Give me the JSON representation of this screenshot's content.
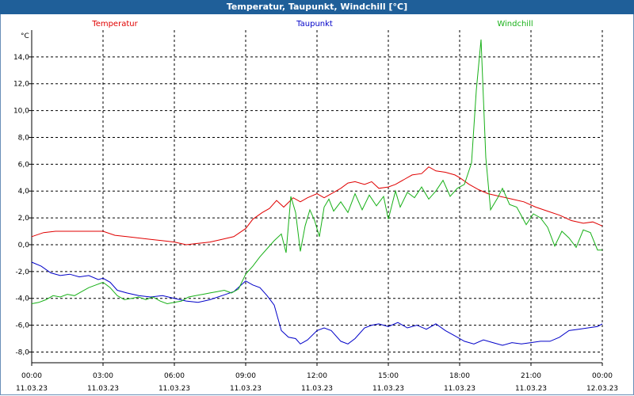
{
  "title": "Temperatur, Taupunkt, Windchill [°C]",
  "chart_data": {
    "type": "line",
    "ylabel": "°C",
    "ylim": [
      -8.8,
      16.0
    ],
    "xlim_hours": [
      0,
      24
    ],
    "y_ticks": [
      "14,0",
      "12,0",
      "10,0",
      "8,0",
      "6,0",
      "4,0",
      "2,0",
      "0,0",
      "-2,0",
      "-4,0",
      "-6,0",
      "-8,0"
    ],
    "y_tick_values": [
      14,
      12,
      10,
      8,
      6,
      4,
      2,
      0,
      -2,
      -4,
      -6,
      -8
    ],
    "x_ticks": [
      {
        "time": "00:00",
        "date": "11.03.23",
        "h": 0
      },
      {
        "time": "03:00",
        "date": "11.03.23",
        "h": 3
      },
      {
        "time": "06:00",
        "date": "11.03.23",
        "h": 6
      },
      {
        "time": "09:00",
        "date": "11.03.23",
        "h": 9
      },
      {
        "time": "12:00",
        "date": "11.03.23",
        "h": 12
      },
      {
        "time": "15:00",
        "date": "11.03.23",
        "h": 15
      },
      {
        "time": "18:00",
        "date": "11.03.23",
        "h": 18
      },
      {
        "time": "21:00",
        "date": "11.03.23",
        "h": 21
      },
      {
        "time": "00:00",
        "date": "12.03.23",
        "h": 24
      }
    ],
    "grid": true,
    "legend_placement": "top",
    "series": [
      {
        "name": "Temperatur",
        "color": "#e00000",
        "points": [
          [
            0,
            0.6
          ],
          [
            0.5,
            0.9
          ],
          [
            1,
            1.0
          ],
          [
            1.5,
            1.0
          ],
          [
            2,
            1.0
          ],
          [
            2.5,
            1.0
          ],
          [
            3,
            1.0
          ],
          [
            3.5,
            0.7
          ],
          [
            4,
            0.6
          ],
          [
            4.5,
            0.5
          ],
          [
            5,
            0.4
          ],
          [
            5.5,
            0.3
          ],
          [
            6,
            0.2
          ],
          [
            6.5,
            0.0
          ],
          [
            7,
            0.1
          ],
          [
            7.5,
            0.2
          ],
          [
            8,
            0.4
          ],
          [
            8.5,
            0.6
          ],
          [
            9,
            1.2
          ],
          [
            9.3,
            1.9
          ],
          [
            9.7,
            2.4
          ],
          [
            10,
            2.7
          ],
          [
            10.3,
            3.3
          ],
          [
            10.6,
            2.8
          ],
          [
            11,
            3.5
          ],
          [
            11.3,
            3.2
          ],
          [
            11.6,
            3.5
          ],
          [
            12,
            3.8
          ],
          [
            12.3,
            3.5
          ],
          [
            12.7,
            3.9
          ],
          [
            13,
            4.2
          ],
          [
            13.3,
            4.6
          ],
          [
            13.6,
            4.7
          ],
          [
            14,
            4.5
          ],
          [
            14.3,
            4.7
          ],
          [
            14.6,
            4.2
          ],
          [
            15,
            4.3
          ],
          [
            15.3,
            4.5
          ],
          [
            15.7,
            4.9
          ],
          [
            16,
            5.2
          ],
          [
            16.4,
            5.3
          ],
          [
            16.7,
            5.8
          ],
          [
            17,
            5.5
          ],
          [
            17.4,
            5.4
          ],
          [
            17.8,
            5.2
          ],
          [
            18,
            5.0
          ],
          [
            18.4,
            4.5
          ],
          [
            18.8,
            4.1
          ],
          [
            19.2,
            3.8
          ],
          [
            19.7,
            3.6
          ],
          [
            20.2,
            3.4
          ],
          [
            20.7,
            3.2
          ],
          [
            21.2,
            2.8
          ],
          [
            21.7,
            2.5
          ],
          [
            22.2,
            2.2
          ],
          [
            22.7,
            1.8
          ],
          [
            23.2,
            1.6
          ],
          [
            23.6,
            1.7
          ],
          [
            24,
            1.4
          ]
        ]
      },
      {
        "name": "Taupunkt",
        "color": "#0000c8",
        "points": [
          [
            0,
            -1.3
          ],
          [
            0.4,
            -1.6
          ],
          [
            0.8,
            -2.1
          ],
          [
            1.2,
            -2.3
          ],
          [
            1.6,
            -2.2
          ],
          [
            2,
            -2.4
          ],
          [
            2.4,
            -2.3
          ],
          [
            2.8,
            -2.6
          ],
          [
            3,
            -2.5
          ],
          [
            3.3,
            -2.8
          ],
          [
            3.6,
            -3.4
          ],
          [
            4,
            -3.6
          ],
          [
            4.5,
            -3.8
          ],
          [
            5,
            -3.9
          ],
          [
            5.5,
            -3.8
          ],
          [
            6,
            -4.0
          ],
          [
            6.5,
            -4.2
          ],
          [
            7,
            -4.3
          ],
          [
            7.5,
            -4.1
          ],
          [
            8,
            -3.8
          ],
          [
            8.5,
            -3.5
          ],
          [
            9,
            -2.7
          ],
          [
            9.3,
            -3.0
          ],
          [
            9.6,
            -3.2
          ],
          [
            9.9,
            -3.8
          ],
          [
            10.2,
            -4.5
          ],
          [
            10.5,
            -6.4
          ],
          [
            10.8,
            -6.9
          ],
          [
            11.1,
            -7.0
          ],
          [
            11.3,
            -7.4
          ],
          [
            11.6,
            -7.1
          ],
          [
            12,
            -6.4
          ],
          [
            12.3,
            -6.2
          ],
          [
            12.6,
            -6.4
          ],
          [
            13,
            -7.2
          ],
          [
            13.3,
            -7.4
          ],
          [
            13.6,
            -7.0
          ],
          [
            14,
            -6.2
          ],
          [
            14.3,
            -6.0
          ],
          [
            14.6,
            -5.9
          ],
          [
            15,
            -6.1
          ],
          [
            15.4,
            -5.8
          ],
          [
            15.8,
            -6.2
          ],
          [
            16.2,
            -6.0
          ],
          [
            16.6,
            -6.3
          ],
          [
            17,
            -5.9
          ],
          [
            17.4,
            -6.4
          ],
          [
            17.8,
            -6.8
          ],
          [
            18.2,
            -7.2
          ],
          [
            18.6,
            -7.4
          ],
          [
            19,
            -7.1
          ],
          [
            19.4,
            -7.3
          ],
          [
            19.8,
            -7.5
          ],
          [
            20.2,
            -7.3
          ],
          [
            20.6,
            -7.4
          ],
          [
            21,
            -7.3
          ],
          [
            21.4,
            -7.2
          ],
          [
            21.8,
            -7.2
          ],
          [
            22.2,
            -6.9
          ],
          [
            22.6,
            -6.4
          ],
          [
            23,
            -6.3
          ],
          [
            23.4,
            -6.2
          ],
          [
            23.8,
            -6.1
          ],
          [
            24,
            -5.9
          ]
        ]
      },
      {
        "name": "Windchill",
        "color": "#18b018",
        "points": [
          [
            0,
            -4.4
          ],
          [
            0.3,
            -4.3
          ],
          [
            0.6,
            -4.1
          ],
          [
            0.9,
            -3.8
          ],
          [
            1.2,
            -3.9
          ],
          [
            1.5,
            -3.7
          ],
          [
            1.8,
            -3.8
          ],
          [
            2.1,
            -3.5
          ],
          [
            2.4,
            -3.2
          ],
          [
            2.7,
            -3.0
          ],
          [
            3,
            -2.8
          ],
          [
            3.3,
            -3.2
          ],
          [
            3.6,
            -3.8
          ],
          [
            3.9,
            -4.1
          ],
          [
            4.2,
            -4.0
          ],
          [
            4.5,
            -3.9
          ],
          [
            4.8,
            -4.1
          ],
          [
            5.1,
            -3.9
          ],
          [
            5.4,
            -4.2
          ],
          [
            5.7,
            -4.4
          ],
          [
            6,
            -4.3
          ],
          [
            6.3,
            -4.2
          ],
          [
            6.6,
            -3.9
          ],
          [
            6.9,
            -3.8
          ],
          [
            7.2,
            -3.7
          ],
          [
            7.5,
            -3.6
          ],
          [
            7.8,
            -3.5
          ],
          [
            8.1,
            -3.4
          ],
          [
            8.4,
            -3.6
          ],
          [
            8.7,
            -3.3
          ],
          [
            9,
            -2.2
          ],
          [
            9.3,
            -1.6
          ],
          [
            9.6,
            -0.9
          ],
          [
            9.9,
            -0.3
          ],
          [
            10.2,
            0.3
          ],
          [
            10.5,
            0.8
          ],
          [
            10.7,
            -0.6
          ],
          [
            10.9,
            3.6
          ],
          [
            11.1,
            2.4
          ],
          [
            11.3,
            -0.5
          ],
          [
            11.5,
            1.4
          ],
          [
            11.7,
            2.6
          ],
          [
            11.9,
            1.8
          ],
          [
            12.1,
            0.6
          ],
          [
            12.3,
            2.8
          ],
          [
            12.5,
            3.4
          ],
          [
            12.7,
            2.5
          ],
          [
            13,
            3.2
          ],
          [
            13.3,
            2.4
          ],
          [
            13.6,
            3.8
          ],
          [
            13.9,
            2.6
          ],
          [
            14.2,
            3.7
          ],
          [
            14.5,
            2.9
          ],
          [
            14.8,
            3.6
          ],
          [
            15,
            1.9
          ],
          [
            15.3,
            4.0
          ],
          [
            15.5,
            2.8
          ],
          [
            15.8,
            3.9
          ],
          [
            16.1,
            3.5
          ],
          [
            16.4,
            4.3
          ],
          [
            16.7,
            3.4
          ],
          [
            17,
            4.0
          ],
          [
            17.3,
            4.8
          ],
          [
            17.6,
            3.6
          ],
          [
            17.9,
            4.2
          ],
          [
            18.2,
            4.5
          ],
          [
            18.5,
            6.1
          ],
          [
            18.7,
            11.5
          ],
          [
            18.9,
            15.3
          ],
          [
            19.1,
            6.5
          ],
          [
            19.3,
            2.6
          ],
          [
            19.6,
            3.5
          ],
          [
            19.8,
            4.2
          ],
          [
            20.1,
            3.0
          ],
          [
            20.4,
            2.8
          ],
          [
            20.8,
            1.5
          ],
          [
            21.1,
            2.3
          ],
          [
            21.4,
            2.0
          ],
          [
            21.7,
            1.3
          ],
          [
            22,
            -0.1
          ],
          [
            22.3,
            1.0
          ],
          [
            22.6,
            0.5
          ],
          [
            22.9,
            -0.2
          ],
          [
            23.2,
            1.1
          ],
          [
            23.5,
            0.9
          ],
          [
            23.8,
            -0.4
          ],
          [
            24,
            -0.4
          ]
        ]
      }
    ]
  }
}
